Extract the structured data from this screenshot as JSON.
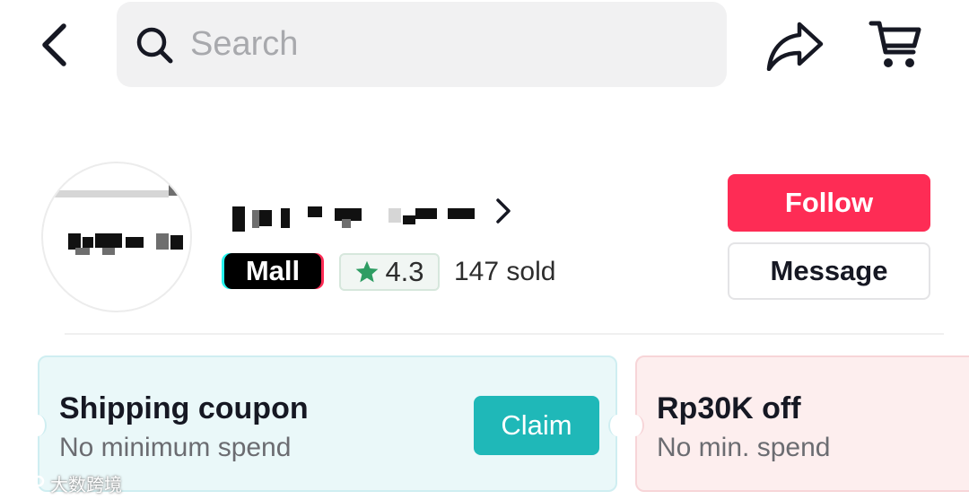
{
  "header": {
    "back_icon": "chevron-left-icon",
    "search": {
      "placeholder": "Search",
      "value": "",
      "icon": "search-icon"
    },
    "share_icon": "share-arrow-icon",
    "cart_icon": "cart-icon"
  },
  "shop": {
    "avatar_icon": "shop-avatar",
    "name_chevron_icon": "chevron-right-icon",
    "mall_badge": "Mall",
    "rating": {
      "icon": "star-icon",
      "value": "4.3"
    },
    "sold": "147 sold",
    "follow_label": "Follow",
    "message_label": "Message"
  },
  "coupons": [
    {
      "title": "Shipping coupon",
      "subtitle": "No minimum spend",
      "action_label": "Claim"
    },
    {
      "title": "Rp30K off",
      "subtitle": "No min. spend"
    }
  ],
  "watermark": {
    "text": "大数跨境"
  },
  "colors": {
    "accent_red": "#fe2c55",
    "teal": "#1fb8b8",
    "search_bg": "#f1f1f2",
    "rating_star": "#2e9d63",
    "coupon_shipping_bg": "#eaf8f9",
    "coupon_discount_bg": "#fdeeee"
  }
}
